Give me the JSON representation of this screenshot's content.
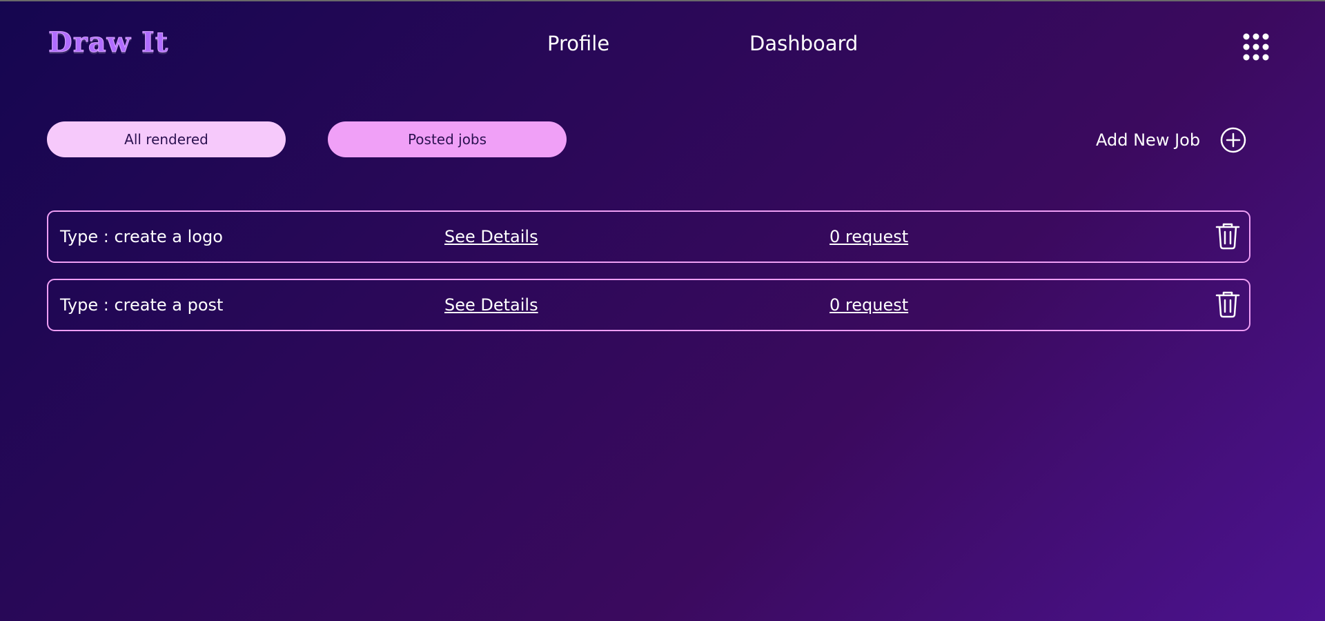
{
  "app": {
    "logo_text": "Draw It"
  },
  "nav": {
    "items": [
      {
        "label": "Profile"
      },
      {
        "label": "Dashboard"
      }
    ],
    "menu_icon": "apps-grid-icon"
  },
  "tabs": [
    {
      "label": "All rendered"
    },
    {
      "label": "Posted jobs"
    }
  ],
  "add_job": {
    "label": "Add New Job",
    "icon": "plus-circle-icon"
  },
  "jobs": [
    {
      "type": "Type : create a logo",
      "details_label": "See Details",
      "requests": "0 request",
      "delete_icon": "trash-icon"
    },
    {
      "type": "Type : create a post",
      "details_label": "See Details",
      "requests": "0 request",
      "delete_icon": "trash-icon"
    }
  ],
  "colors": {
    "background_start": "#150650",
    "background_end": "#4c1390",
    "tab_all_rendered": "#f6c9fb",
    "tab_posted_jobs": "#f0a0f7",
    "card_border": "#ef9ff5",
    "logo": "#b06cff"
  }
}
